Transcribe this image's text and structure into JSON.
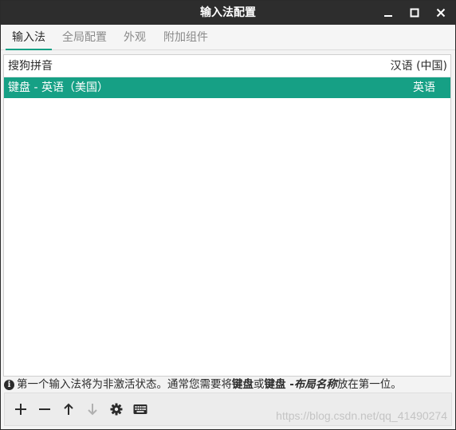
{
  "window": {
    "title": "输入法配置",
    "controls": [
      "minimize-icon",
      "maximize-icon",
      "close-icon"
    ]
  },
  "tabs": [
    {
      "label": "输入法",
      "active": true
    },
    {
      "label": "全局配置",
      "active": false
    },
    {
      "label": "外观",
      "active": false
    },
    {
      "label": "附加组件",
      "active": false
    }
  ],
  "list": {
    "header": {
      "name": "搜狗拼音",
      "language": "汉语 (中国)"
    },
    "rows": [
      {
        "name": "键盘 - 英语（美国）",
        "language": "英语",
        "selected": true
      }
    ]
  },
  "info": {
    "icon": "info-icon",
    "text_before": "第一个输入法将为非激活状态。通常您需要将",
    "bold_1": "键盘",
    "text_middle": "或",
    "bold_2": "键盘 - ",
    "italic_bold": "布局名称",
    "text_after": "放在第一位。"
  },
  "toolbar": {
    "buttons": [
      {
        "icon": "add-icon",
        "enabled": true
      },
      {
        "icon": "remove-icon",
        "enabled": true
      },
      {
        "icon": "arrow-up-icon",
        "enabled": true
      },
      {
        "icon": "arrow-down-icon",
        "enabled": false
      },
      {
        "icon": "gear-icon",
        "enabled": true
      },
      {
        "icon": "keyboard-icon",
        "enabled": true
      }
    ]
  },
  "watermark": "https://blog.csdn.net/qq_41490274",
  "colors": {
    "titlebar": "#2d2d2d",
    "accent": "#16a085",
    "background": "#f3f3f3",
    "disabled": "#b0b0b0"
  }
}
